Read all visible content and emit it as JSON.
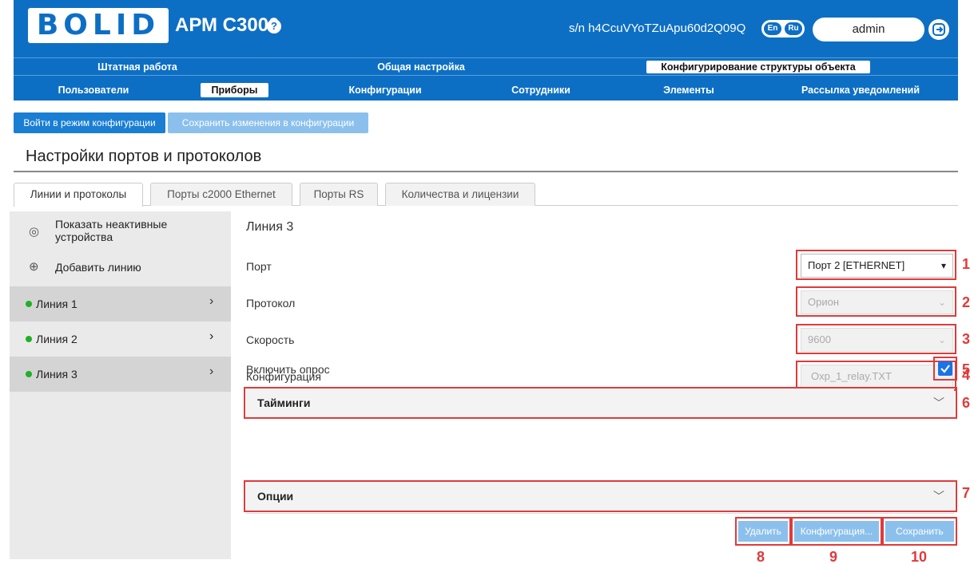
{
  "header": {
    "logo_text": "BOLID",
    "app_title": "АРМ С3000",
    "help_icon": "?",
    "serial": "s/n h4CcuVYoTZuApu60d2Q09Q",
    "lang_en": "En",
    "lang_ru": "Ru",
    "user": "admin",
    "brand_color": "#0d6fc4"
  },
  "nav1": [
    "Штатная работа",
    "Общая настройка",
    "Конфигурирование структуры объекта"
  ],
  "nav2": [
    "Пользователи",
    "Приборы",
    "Конфигурации",
    "Сотрудники",
    "Элементы",
    "Рассылка уведомлений"
  ],
  "actions": {
    "enter_config": "Войти в режим конфигурации",
    "save_config": "Сохранить изменения в конфигурации"
  },
  "page_title": "Настройки портов и протоколов",
  "tabs": [
    "Линии и протоколы",
    "Порты с2000 Ethernet",
    "Порты RS",
    "Количества и лицензии"
  ],
  "sidebar": {
    "show_inactive": "Показать неактивные устройства",
    "add_line": "Добавить линию",
    "lines": [
      "Линия 1",
      "Линия 2",
      "Линия 3"
    ],
    "status_color": "#1fb026"
  },
  "form": {
    "title": "Линия 3",
    "port_label": "Порт",
    "port_value": "Порт 2 [ETHERNET]",
    "protocol_label": "Протокол",
    "protocol_value": "Орион",
    "speed_label": "Скорость",
    "speed_value": "9600",
    "config_label": "Конфигурация",
    "config_value": "Oxp_1_relay.TXT",
    "poll_label": "Включить опрос",
    "timings": "Тайминги",
    "options": "Опции"
  },
  "buttons": {
    "delete": "Удалить",
    "configuration": "Конфигурация...",
    "save": "Сохранить"
  },
  "markers": [
    "1",
    "2",
    "3",
    "4",
    "5",
    "6",
    "7",
    "8",
    "9",
    "10"
  ]
}
